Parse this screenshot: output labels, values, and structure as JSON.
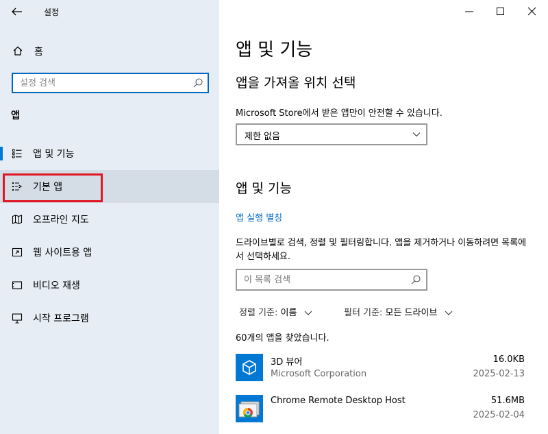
{
  "window": {
    "title": "설정"
  },
  "sidebar": {
    "home_label": "홈",
    "search_placeholder": "설정 검색",
    "section_label": "앱",
    "items": [
      {
        "label": "앱 및 기능",
        "icon": "apps-list-icon"
      },
      {
        "label": "기본 앱",
        "icon": "default-apps-icon"
      },
      {
        "label": "오프라인 지도",
        "icon": "offline-maps-icon"
      },
      {
        "label": "웹 사이트용 앱",
        "icon": "apps-for-websites-icon"
      },
      {
        "label": "비디오 재생",
        "icon": "video-playback-icon"
      },
      {
        "label": "시작 프로그램",
        "icon": "startup-icon"
      }
    ]
  },
  "main": {
    "page_title": "앱 및 기능",
    "install_section": {
      "title": "앱을 가져올 위치 선택",
      "description": "Microsoft Store에서 받은 앱만이 안전할 수 있습니다.",
      "dropdown_value": "제한 없음"
    },
    "apps_section": {
      "title": "앱 및 기능",
      "alias_link": "앱 실행 별칭",
      "description": "드라이브별로 검색, 정렬 및 필터링합니다. 앱을 제거하거나 이동하려면 목록에서 선택하세요.",
      "search_placeholder": "이 목록 검색",
      "sort_label": "정렬 기준:",
      "sort_value": "이름",
      "filter_label": "필터 기준:",
      "filter_value": "모든 드라이브",
      "count_text": "60개의 앱을 찾았습니다."
    },
    "apps": [
      {
        "name": "3D 뷰어",
        "publisher": "Microsoft Corporation",
        "size": "16.0KB",
        "date": "2025-02-13",
        "icon": "3d-viewer-icon"
      },
      {
        "name": "Chrome Remote Desktop Host",
        "publisher": "",
        "size": "51.6MB",
        "date": "2025-02-04",
        "icon": "chrome-remote-desktop-icon"
      }
    ]
  },
  "colors": {
    "accent": "#0078d4",
    "link": "#0067c0",
    "sidebar_bg": "#e6edf4",
    "highlight": "#e0151f"
  }
}
